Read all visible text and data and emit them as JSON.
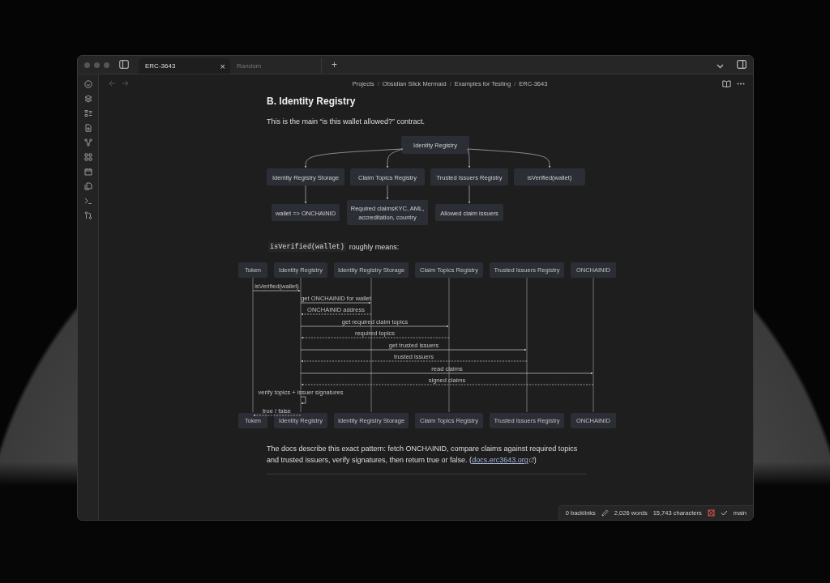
{
  "tabs": [
    {
      "label": "ERC-3643",
      "selected": true,
      "close": "×"
    },
    {
      "label": "Random",
      "selected": false
    }
  ],
  "new_tab": "+",
  "breadcrumb": {
    "separator": "/",
    "items": [
      "Projects",
      "Obsidian Slick Mermaid",
      "Examples for Testing",
      "ERC-3643"
    ]
  },
  "heading": "B. Identity Registry",
  "intro": "This is the main “is this wallet allowed?” contract.",
  "flowchart": {
    "root": "Identity Registry",
    "branches": [
      {
        "label": "Identity Registry Storage",
        "child": [
          "wallet => ONCHAINID"
        ]
      },
      {
        "label": "Claim Topics Registry",
        "child": [
          "Required claimsKYC, AML,",
          "accreditation, country"
        ]
      },
      {
        "label": "Trusted Issuers Registry",
        "child": [
          "Allowed claim issuers"
        ]
      },
      {
        "label": "isVerified(wallet)"
      }
    ]
  },
  "code_line": {
    "code": "isVerified(wallet)",
    "text": "roughly means:"
  },
  "sequence": {
    "participants_top": [
      "Token",
      "Identity Registry",
      "Identity Registry Storage",
      "Claim Topics Registry",
      "Trusted Issuers Registry",
      "ONCHAINID"
    ],
    "participants_bottom": [
      "Token",
      "Identity Registry",
      "Identity Registry Storage",
      "Claim Topics Registry",
      "Trusted Issuers Registry",
      "ONCHAINID"
    ],
    "messages": [
      {
        "kind": "call",
        "label": "isVerified(wallet)"
      },
      {
        "kind": "call",
        "label": "get ONCHAINID for wallet"
      },
      {
        "kind": "return",
        "label": "ONCHAINID address"
      },
      {
        "kind": "call",
        "label": "get required claim topics"
      },
      {
        "kind": "return",
        "label": "required topics"
      },
      {
        "kind": "call",
        "label": "get trusted issuers"
      },
      {
        "kind": "return",
        "label": "trusted issuers"
      },
      {
        "kind": "call",
        "label": "read claims"
      },
      {
        "kind": "return",
        "label": "signed claims"
      },
      {
        "kind": "self",
        "label": "verify topics + issuer signatures"
      },
      {
        "kind": "return",
        "label": "true / false"
      }
    ]
  },
  "closing": {
    "text": "The docs describe this exact pattern: fetch ONCHAINID, compare claims against required topics and trusted issuers, verify signatures, then return true or false. (",
    "link": "docs.erc3643.org",
    "after": ")"
  },
  "status_bar": {
    "backlinks": "0 backlinks",
    "words": "2,026 words",
    "characters": "15,743 characters",
    "branch": "main"
  }
}
